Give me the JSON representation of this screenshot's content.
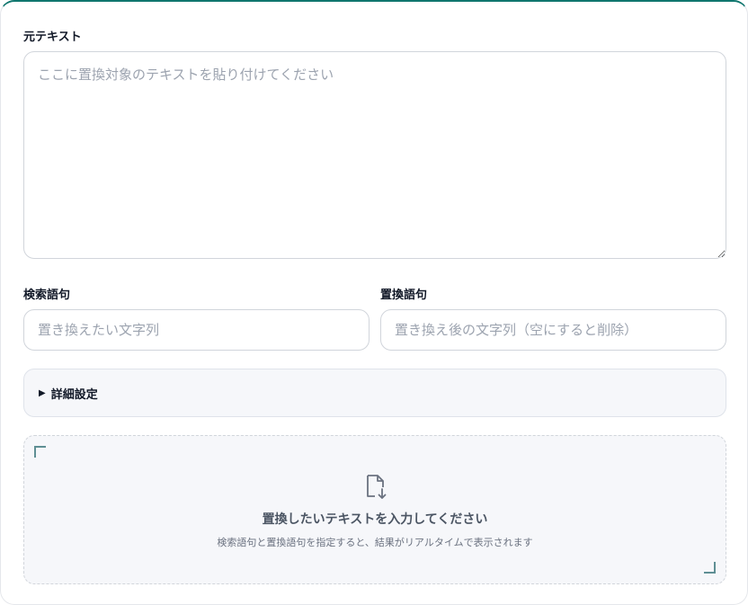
{
  "source": {
    "label": "元テキスト",
    "placeholder": "ここに置換対象のテキストを貼り付けてください",
    "value": ""
  },
  "search": {
    "label": "検索語句",
    "placeholder": "置き換えたい文字列",
    "value": ""
  },
  "replace": {
    "label": "置換語句",
    "placeholder": "置き換え後の文字列（空にすると削除）",
    "value": ""
  },
  "details": {
    "toggle_icon": "▶",
    "label": "詳細設定"
  },
  "result": {
    "icon": "document-download-icon",
    "title": "置換したいテキストを入力してください",
    "subtitle": "検索語句と置換語句を指定すると、結果がリアルタイムで表示されます"
  },
  "colors": {
    "accent": "#0f766e",
    "border": "#d1d5db",
    "panel_bg": "#f6f7fa",
    "corner": "#5f8f94",
    "placeholder": "#9ca3af"
  }
}
